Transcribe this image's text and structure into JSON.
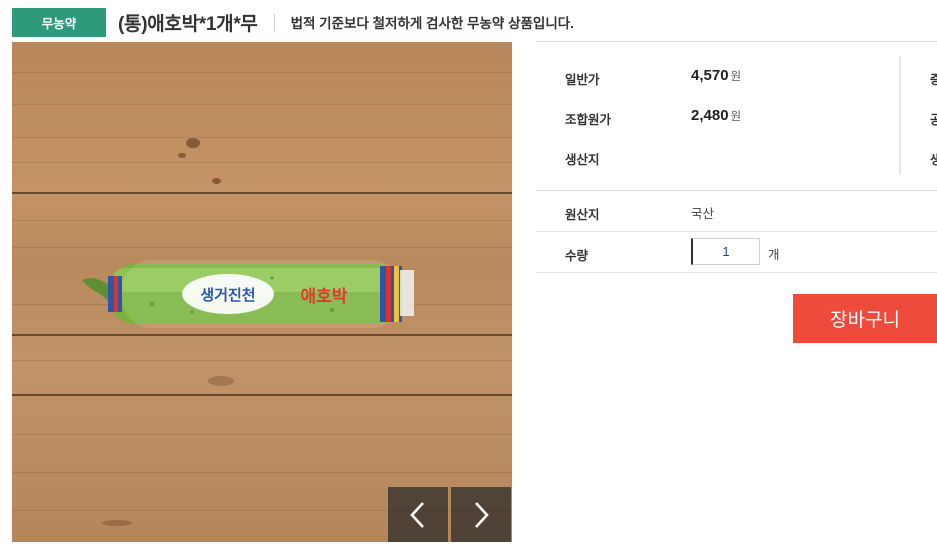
{
  "header": {
    "badge": "무농약",
    "title": "(통)애호박*1개*무",
    "subtitle": "법적 기준보다 철저하게 검사한 무농약 상품입니다."
  },
  "product_image": {
    "package_text": "생거진천",
    "package_brand": "애호박"
  },
  "gallery": {
    "prev_icon": "chevron-left-icon",
    "next_icon": "chevron-right-icon"
  },
  "pricing": {
    "regular_label": "일반가",
    "regular_value": "4,570",
    "member_label": "조합원가",
    "member_value": "2,480",
    "currency": "원",
    "producer_label": "생산지",
    "right_cut": [
      "증",
      "공",
      "생"
    ]
  },
  "origin": {
    "label": "원산지",
    "value": "국산"
  },
  "quantity": {
    "label": "수량",
    "value": "1",
    "unit": "개"
  },
  "cart_button": "장바구니",
  "colors": {
    "badge": "#2e9a7b",
    "cart": "#ef4b3c",
    "qty_text": "#2c3a8c"
  }
}
